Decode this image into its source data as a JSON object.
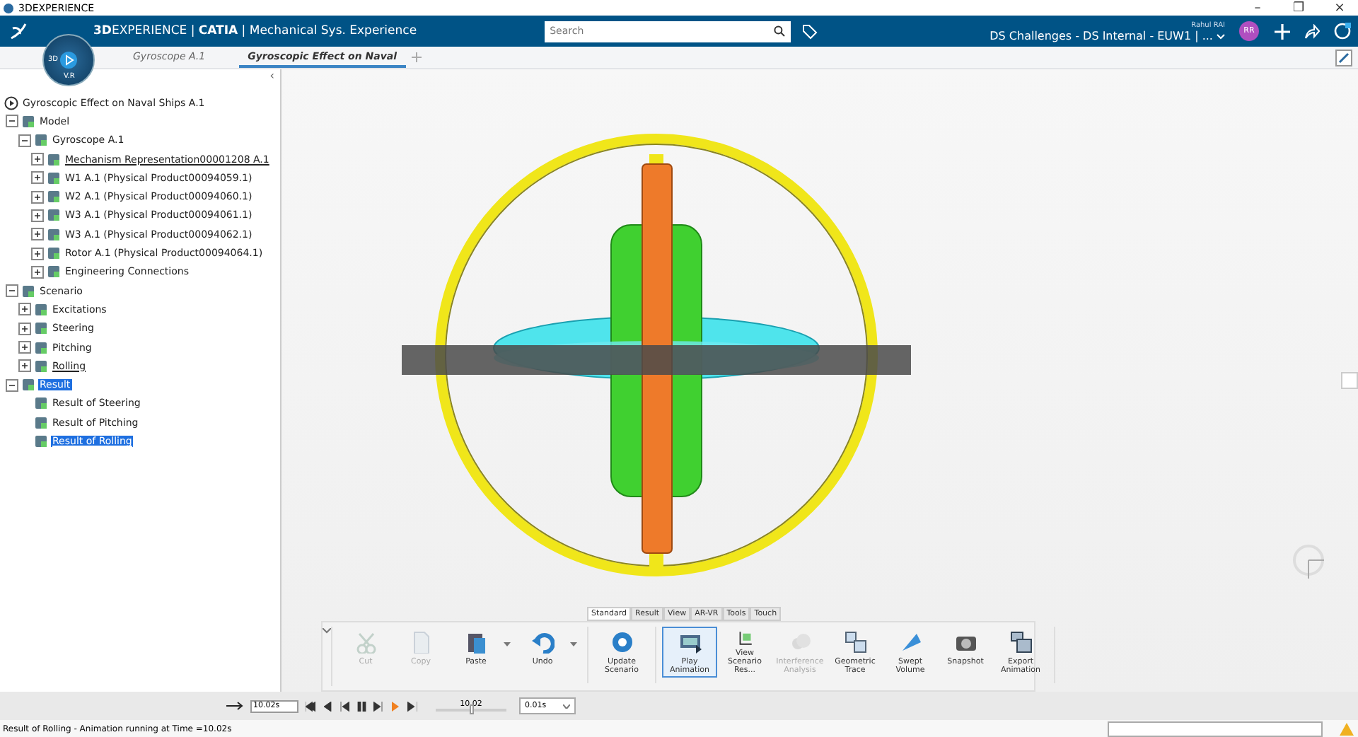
{
  "window": {
    "title": "3DEXPERIENCE",
    "controls": [
      "–",
      "❐",
      "×"
    ]
  },
  "header": {
    "compass": {
      "left": "3D",
      "bottom": "V.R"
    },
    "brand": "**3D**EXPERIENCE | **CATIA** | Mechanical Sys. Experience",
    "search": {
      "placeholder": "Search"
    },
    "user": "Rahul RAI",
    "tenant": "DS Challenges - DS Internal - EUW1 | ...",
    "avatar": "RR"
  },
  "tabs": [
    {
      "label": "Gyroscope A.1",
      "selected": false
    },
    {
      "label": "Gyroscopic Effect on Naval",
      "selected": true
    }
  ],
  "tree": {
    "collapse": "‹",
    "root": {
      "label": "Gyroscopic Effect on Naval Ships A.1",
      "children": [
        {
          "label": "Model",
          "expanded": true,
          "selected": false,
          "underlined": false,
          "children": [
            {
              "label": "Gyroscope A.1",
              "expanded": true,
              "selected": false,
              "underlined": false,
              "children": [
                {
                  "label": "Mechanism Representation00001208 A.1",
                  "expanded": false,
                  "selected": false,
                  "underlined": true
                },
                {
                  "label": "W1 A.1 (Physical Product00094059.1)",
                  "expanded": false,
                  "selected": false,
                  "underlined": false
                },
                {
                  "label": "W2 A.1 (Physical Product00094060.1)",
                  "expanded": false,
                  "selected": false,
                  "underlined": false
                },
                {
                  "label": "W3 A.1 (Physical Product00094061.1)",
                  "expanded": false,
                  "selected": false,
                  "underlined": false
                },
                {
                  "label": "W3 A.1 (Physical Product00094062.1)",
                  "expanded": false,
                  "selected": false,
                  "underlined": false
                },
                {
                  "label": "Rotor A.1 (Physical Product00094064.1)",
                  "expanded": false,
                  "selected": false,
                  "underlined": false
                },
                {
                  "label": "Engineering Connections",
                  "expanded": false,
                  "selected": false,
                  "underlined": false
                }
              ]
            }
          ]
        },
        {
          "label": "Scenario",
          "expanded": true,
          "selected": false,
          "underlined": false,
          "children": [
            {
              "label": "Excitations",
              "expanded": false,
              "selected": false,
              "underlined": false
            },
            {
              "label": "Steering",
              "expanded": false,
              "selected": false,
              "underlined": false
            },
            {
              "label": "Pitching",
              "expanded": false,
              "selected": false,
              "underlined": false
            },
            {
              "label": "Rolling",
              "expanded": false,
              "selected": false,
              "underlined": true
            }
          ]
        },
        {
          "label": "Result",
          "expanded": true,
          "selected": true,
          "underlined": false,
          "children": [
            {
              "label": "Result of Steering",
              "selected": false,
              "underlined": false
            },
            {
              "label": "Result of Pitching",
              "selected": false,
              "underlined": false
            },
            {
              "label": "Result of Rolling",
              "selected": true,
              "underlined": true
            }
          ]
        }
      ]
    }
  },
  "action_bar": {
    "tabs": [
      {
        "label": "Standard",
        "selected": true
      },
      {
        "label": "Result",
        "selected": false
      },
      {
        "label": "View",
        "selected": false
      },
      {
        "label": "AR-VR",
        "selected": false
      },
      {
        "label": "Tools",
        "selected": false
      },
      {
        "label": "Touch",
        "selected": false
      }
    ],
    "groups": [
      [
        {
          "label": "Cut",
          "disabled": true,
          "selected": false,
          "menu": false
        },
        {
          "label": "Copy",
          "disabled": true,
          "selected": false,
          "menu": false
        },
        {
          "label": "Paste",
          "disabled": false,
          "selected": false,
          "menu": true
        },
        {
          "label": "Undo",
          "disabled": false,
          "selected": false,
          "menu": true
        }
      ],
      [
        {
          "label": "Update Scenario",
          "disabled": false,
          "selected": false,
          "menu": false
        }
      ],
      [
        {
          "label": "Play Animation",
          "disabled": false,
          "selected": true,
          "menu": false
        },
        {
          "label": "View Scenario Res...",
          "disabled": false,
          "selected": false,
          "menu": false
        },
        {
          "label": "Interference Analysis",
          "disabled": true,
          "selected": false,
          "menu": false
        },
        {
          "label": "Geometric Trace",
          "disabled": false,
          "selected": false,
          "menu": false
        },
        {
          "label": "Swept Volume",
          "disabled": false,
          "selected": false,
          "menu": false
        },
        {
          "label": "Snapshot",
          "disabled": false,
          "selected": false,
          "menu": false
        },
        {
          "label": "Export Animation",
          "disabled": false,
          "selected": false,
          "menu": false
        }
      ]
    ]
  },
  "player": {
    "time": "10.02s",
    "slider": {
      "reading": "10.02",
      "level": 0.5
    },
    "step": "0.01s"
  },
  "status_bar": {
    "message": "Result of Rolling - Animation running at Time =10.02s"
  }
}
